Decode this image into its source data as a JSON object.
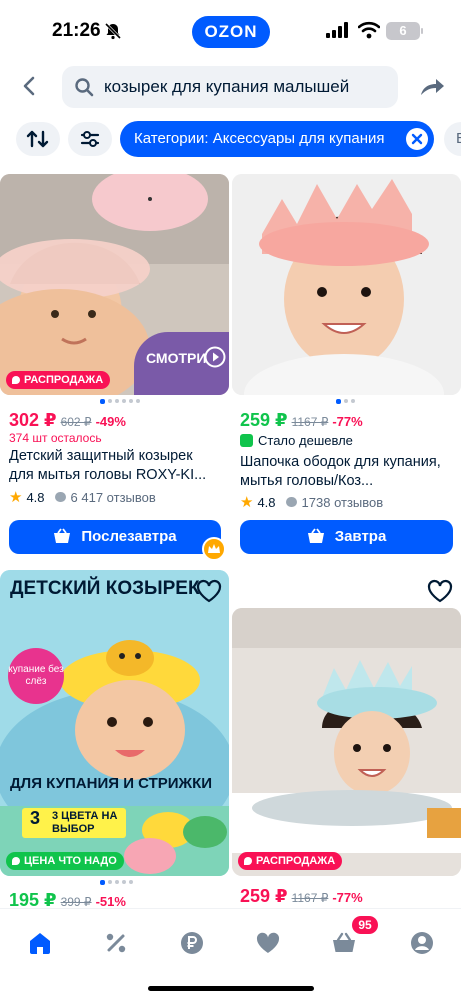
{
  "status_bar": {
    "time": "21:26",
    "brand": "OZON",
    "battery": "6"
  },
  "search": {
    "query": "козырек для купания малышей"
  },
  "filters": {
    "category_chip": "Категории: Аксессуары для купания",
    "next_chip": "B"
  },
  "products": [
    {
      "price": "302 ₽",
      "old_price": "602 ₽",
      "discount": "-49%",
      "stock": "374 шт осталось",
      "title": "Детский защитный козырек для мытья головы ROXY-KI...",
      "rating": "4.8",
      "reviews": "6 417 отзывов",
      "delivery": "Послезавтра",
      "badge": "РАСПРОДАЖА",
      "video_label": "СМОТРИ"
    },
    {
      "price": "259 ₽",
      "old_price": "1167 ₽",
      "discount": "-77%",
      "cheaper_label": "Стало дешевле",
      "title": "Шапочка ободок для купания, мытья головы/Коз...",
      "rating": "4.8",
      "reviews": "1738 отзывов",
      "delivery": "Завтра"
    },
    {
      "image_headline": "ДЕТСКИЙ КОЗЫРЕК",
      "image_sticker": "купание без слёз",
      "image_caption": "ДЛЯ КУПАНИЯ И СТРИЖКИ",
      "image_colors": "3 ЦВЕТА НА ВЫБОР",
      "badge": "ЦЕНА ЧТО НАДО",
      "price": "195 ₽",
      "old_price": "399 ₽",
      "discount": "-51%"
    },
    {
      "badge": "РАСПРОДАЖА",
      "price": "259 ₽",
      "old_price": "1167 ₽",
      "discount": "-77%"
    }
  ],
  "tabbar": {
    "cart_count": "95"
  },
  "colors": {
    "accent": "#005bff",
    "sale": "#f91155",
    "green": "#10c44c"
  }
}
